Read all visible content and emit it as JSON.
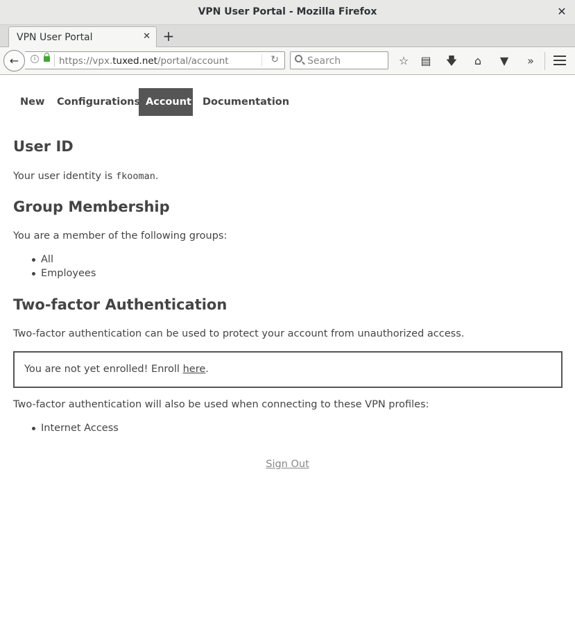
{
  "window": {
    "title": "VPN User Portal - Mozilla Firefox"
  },
  "tabs": [
    {
      "label": "VPN User Portal"
    }
  ],
  "navbar": {
    "url_prefix": "https://vpx.",
    "url_host": "tuxed.net",
    "url_path": "/portal/account",
    "search_placeholder": "Search"
  },
  "page_nav": {
    "items": [
      {
        "label": "New"
      },
      {
        "label": "Configurations"
      },
      {
        "label": "Account"
      },
      {
        "label": "Documentation"
      }
    ],
    "active": "Account"
  },
  "user_id": {
    "heading": "User ID",
    "text_before": "Your user identity is ",
    "user": "fkooman",
    "text_after": "."
  },
  "groups": {
    "heading": "Group Membership",
    "intro": "You are a member of the following groups:",
    "items": [
      "All",
      "Employees"
    ]
  },
  "two_factor": {
    "heading": "Two-factor Authentication",
    "intro": "Two-factor authentication can be used to protect your account from unauthorized access.",
    "notice_before": "You are not yet enrolled! Enroll ",
    "notice_link": "here",
    "notice_after": ".",
    "profiles_intro": "Two-factor authentication will also be used when connecting to these VPN profiles:",
    "profiles": [
      "Internet Access"
    ]
  },
  "footer": {
    "sign_out": "Sign Out"
  }
}
